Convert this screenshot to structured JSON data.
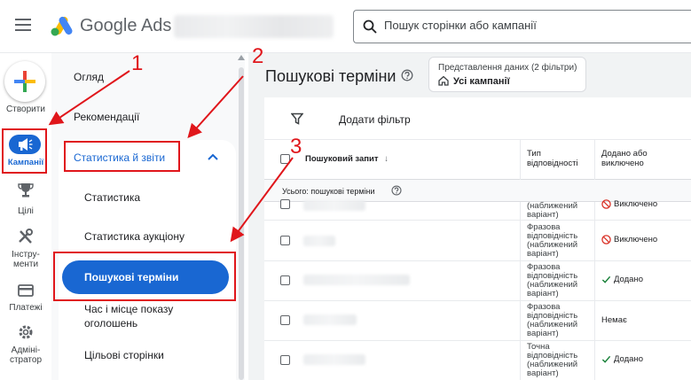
{
  "header": {
    "brand_google": "Google",
    "brand_ads": "Ads",
    "search_placeholder": "Пошук сторінки або кампанії"
  },
  "rail": {
    "create": "Створити",
    "campaigns": "Кампанії",
    "goals": "Цілі",
    "tools_line1": "Інстру-",
    "tools_line2": "менти",
    "billing": "Платежі",
    "admin_line1": "Адміні-",
    "admin_line2": "стратор"
  },
  "subnav": {
    "overview": "Огляд",
    "recommendations": "Рекомендації",
    "section": "Статистика й звіти",
    "stats": "Статистика",
    "auction": "Статистика аукціону",
    "search_terms": "Пошукові терміни",
    "when_where_line1": "Час і місце показу",
    "when_where_line2": "оголошень",
    "landing_pages": "Цільові сторінки"
  },
  "main": {
    "title": "Пошукові терміни",
    "view_sub": "Представлення даних (2 фільтри)",
    "view_value": "Усі кампанії",
    "add_filter": "Додати фільтр",
    "col_query": "Пошуковий запит",
    "col_match_line1": "Тип",
    "col_match_line2": "відповідності",
    "col_added_line1": "Додано або",
    "col_added_line2": "виключено",
    "total_label": "Усього: пошукові терміни"
  },
  "rows": [
    {
      "match": [
        "(наближений",
        "варіант)"
      ],
      "status": "Виключено",
      "state": "excluded",
      "partial": true
    },
    {
      "match": [
        "Фразова",
        "відповідність",
        "(наближений",
        "варіант)"
      ],
      "status": "Виключено",
      "state": "excluded"
    },
    {
      "match": [
        "Фразова",
        "відповідність",
        "(наближений",
        "варіант)"
      ],
      "status": "Додано",
      "state": "added"
    },
    {
      "match": [
        "Фразова",
        "відповідність",
        "(наближений",
        "варіант)"
      ],
      "status": "Немає",
      "state": "none"
    },
    {
      "match": [
        "Точна",
        "відповідність",
        "(наближений",
        "варіант)"
      ],
      "status": "Додано",
      "state": "added"
    }
  ],
  "annotations": [
    "1",
    "2",
    "3"
  ],
  "colors": {
    "accent": "#1967d2",
    "annotation": "#e0161b"
  }
}
